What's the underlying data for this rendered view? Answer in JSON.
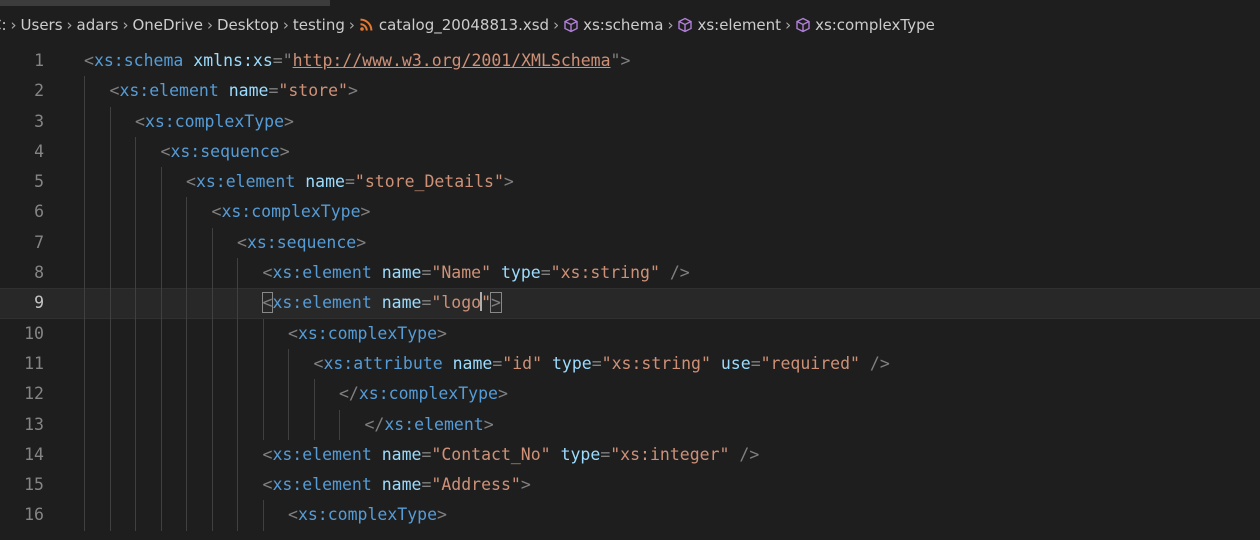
{
  "breadcrumb": {
    "items": [
      "C:",
      "Users",
      "adars",
      "OneDrive",
      "Desktop",
      "testing",
      "catalog_20048813.xsd",
      "xs:schema",
      "xs:element",
      "xs:complexType"
    ]
  },
  "editor": {
    "lines": [
      {
        "n": "1",
        "indent": 0,
        "tokens": [
          [
            "br",
            "<"
          ],
          [
            "tag",
            "xs:schema"
          ],
          [
            "sp",
            " "
          ],
          [
            "attr",
            "xmlns:xs"
          ],
          [
            "br",
            "=\""
          ],
          [
            "url",
            "http://www.w3.org/2001/XMLSchema"
          ],
          [
            "br",
            "\">"
          ]
        ]
      },
      {
        "n": "2",
        "indent": 1,
        "tokens": [
          [
            "br",
            "<"
          ],
          [
            "tag",
            "xs:element"
          ],
          [
            "sp",
            " "
          ],
          [
            "attr",
            "name"
          ],
          [
            "br",
            "="
          ],
          [
            "str",
            "\"store\""
          ],
          [
            "br",
            ">"
          ]
        ]
      },
      {
        "n": "3",
        "indent": 2,
        "tokens": [
          [
            "br",
            "<"
          ],
          [
            "tag",
            "xs:complexType"
          ],
          [
            "br",
            ">"
          ]
        ]
      },
      {
        "n": "4",
        "indent": 3,
        "tokens": [
          [
            "br",
            "<"
          ],
          [
            "tag",
            "xs:sequence"
          ],
          [
            "br",
            ">"
          ]
        ]
      },
      {
        "n": "5",
        "indent": 4,
        "tokens": [
          [
            "br",
            "<"
          ],
          [
            "tag",
            "xs:element"
          ],
          [
            "sp",
            " "
          ],
          [
            "attr",
            "name"
          ],
          [
            "br",
            "="
          ],
          [
            "str",
            "\"store_Details\""
          ],
          [
            "br",
            ">"
          ]
        ]
      },
      {
        "n": "6",
        "indent": 5,
        "tokens": [
          [
            "br",
            "<"
          ],
          [
            "tag",
            "xs:complexType"
          ],
          [
            "br",
            ">"
          ]
        ]
      },
      {
        "n": "7",
        "indent": 6,
        "tokens": [
          [
            "br",
            "<"
          ],
          [
            "tag",
            "xs:sequence"
          ],
          [
            "br",
            ">"
          ]
        ]
      },
      {
        "n": "8",
        "indent": 7,
        "tokens": [
          [
            "br",
            "<"
          ],
          [
            "tag",
            "xs:element"
          ],
          [
            "sp",
            " "
          ],
          [
            "attr",
            "name"
          ],
          [
            "br",
            "="
          ],
          [
            "str",
            "\"Name\""
          ],
          [
            "sp",
            " "
          ],
          [
            "attr",
            "type"
          ],
          [
            "br",
            "="
          ],
          [
            "str",
            "\"xs:string\""
          ],
          [
            "sp",
            " "
          ],
          [
            "br",
            "/>"
          ]
        ]
      },
      {
        "n": "9",
        "indent": 7,
        "current": true,
        "tokens": [
          [
            "brm",
            "<"
          ],
          [
            "tag",
            "xs:element"
          ],
          [
            "sp",
            " "
          ],
          [
            "attr",
            "name"
          ],
          [
            "br",
            "="
          ],
          [
            "str",
            "\"logo"
          ],
          [
            "cursor",
            ""
          ],
          [
            "str",
            "\""
          ],
          [
            "brm",
            ">"
          ]
        ]
      },
      {
        "n": "10",
        "indent": 8,
        "tokens": [
          [
            "br",
            "<"
          ],
          [
            "tag",
            "xs:complexType"
          ],
          [
            "br",
            ">"
          ]
        ]
      },
      {
        "n": "11",
        "indent": 9,
        "tokens": [
          [
            "br",
            "<"
          ],
          [
            "tag",
            "xs:attribute"
          ],
          [
            "sp",
            " "
          ],
          [
            "attr",
            "name"
          ],
          [
            "br",
            "="
          ],
          [
            "str",
            "\"id\""
          ],
          [
            "sp",
            " "
          ],
          [
            "attr",
            "type"
          ],
          [
            "br",
            "="
          ],
          [
            "str",
            "\"xs:string\""
          ],
          [
            "sp",
            " "
          ],
          [
            "attr",
            "use"
          ],
          [
            "br",
            "="
          ],
          [
            "str",
            "\"required\""
          ],
          [
            "sp",
            " "
          ],
          [
            "br",
            "/>"
          ]
        ]
      },
      {
        "n": "12",
        "indent": 10,
        "tokens": [
          [
            "br",
            "</"
          ],
          [
            "tag",
            "xs:complexType"
          ],
          [
            "br",
            ">"
          ]
        ]
      },
      {
        "n": "13",
        "indent": 11,
        "tokens": [
          [
            "br",
            "</"
          ],
          [
            "tag",
            "xs:element"
          ],
          [
            "br",
            ">"
          ]
        ]
      },
      {
        "n": "14",
        "indent": 7,
        "tokens": [
          [
            "br",
            "<"
          ],
          [
            "tag",
            "xs:element"
          ],
          [
            "sp",
            " "
          ],
          [
            "attr",
            "name"
          ],
          [
            "br",
            "="
          ],
          [
            "str",
            "\"Contact_No\""
          ],
          [
            "sp",
            " "
          ],
          [
            "attr",
            "type"
          ],
          [
            "br",
            "="
          ],
          [
            "str",
            "\"xs:integer\""
          ],
          [
            "sp",
            " "
          ],
          [
            "br",
            "/>"
          ]
        ]
      },
      {
        "n": "15",
        "indent": 7,
        "tokens": [
          [
            "br",
            "<"
          ],
          [
            "tag",
            "xs:element"
          ],
          [
            "sp",
            " "
          ],
          [
            "attr",
            "name"
          ],
          [
            "br",
            "="
          ],
          [
            "str",
            "\"Address\""
          ],
          [
            "br",
            ">"
          ]
        ]
      },
      {
        "n": "16",
        "indent": 8,
        "tokens": [
          [
            "br",
            "<"
          ],
          [
            "tag",
            "xs:complexType"
          ],
          [
            "br",
            ">"
          ]
        ]
      }
    ]
  },
  "colors": {
    "background": "#1e1e1e",
    "tag": "#569cd6",
    "attribute": "#9cdcfe",
    "string": "#ce9178",
    "bracket": "#808080",
    "line_number": "#858585"
  }
}
